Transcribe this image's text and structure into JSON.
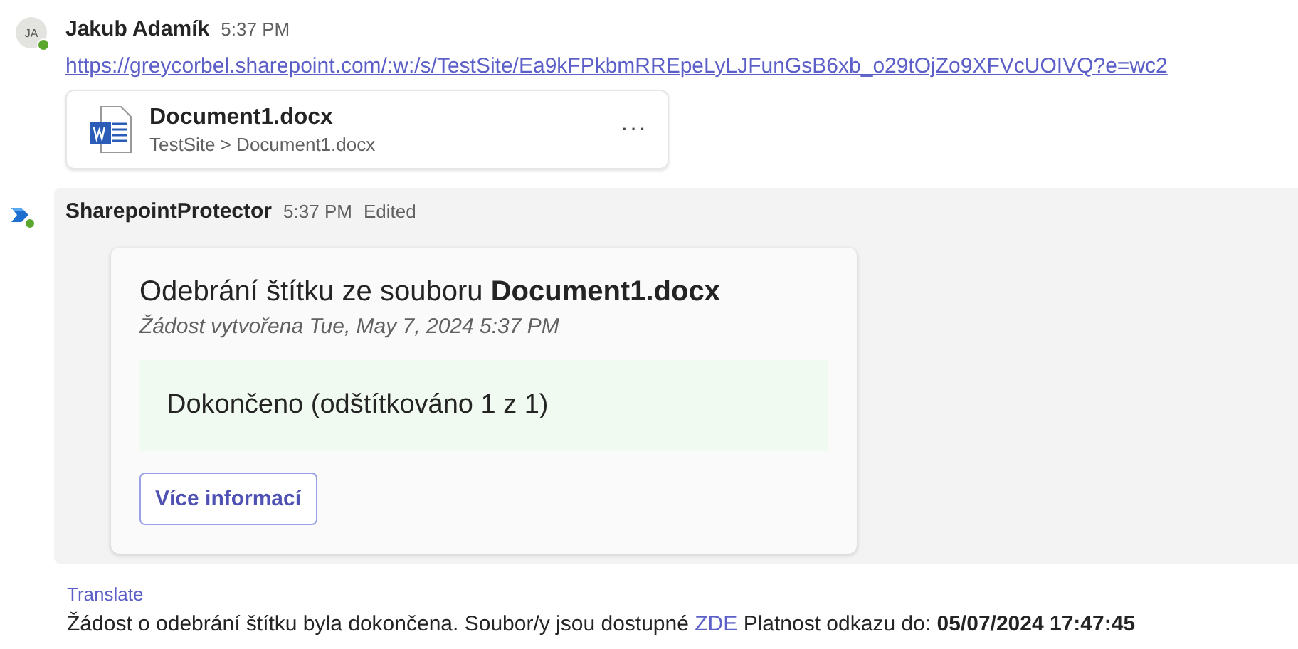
{
  "messages": [
    {
      "kind": "user",
      "avatar": "JA",
      "online": true,
      "author": "Jakub Adamík",
      "time": "5:37 PM",
      "link": "https://greycorbel.sharepoint.com/:w:/s/TestSite/Ea9kFPkbmRREpeLyLJFunGsB6xb_o29tOjZo9XFVcUOIVQ?e=wc2",
      "attachment": {
        "name": "Document1.docx",
        "path": "TestSite > Document1.docx",
        "menu": "···"
      }
    },
    {
      "kind": "bot",
      "online": true,
      "author": "SharepointProtector",
      "time": "5:37 PM",
      "edited": "Edited",
      "card": {
        "title": "Odebrání štítku ze souboru **Document1.docx**",
        "subtitle": "Žádost vytvořena Tue, May 7, 2024 5:37 PM",
        "status": "Dokončeno (odštítkováno 1 z 1)",
        "button": "Více informací"
      },
      "translate": "Translate",
      "text_before": "Žádost o odebrání štítku byla dokončena. Soubor/y jsou dostupné",
      "text_link": "ZDE",
      "text_after": "Platnost odkazu do: **05/07/2024 17:47:45**"
    }
  ]
}
